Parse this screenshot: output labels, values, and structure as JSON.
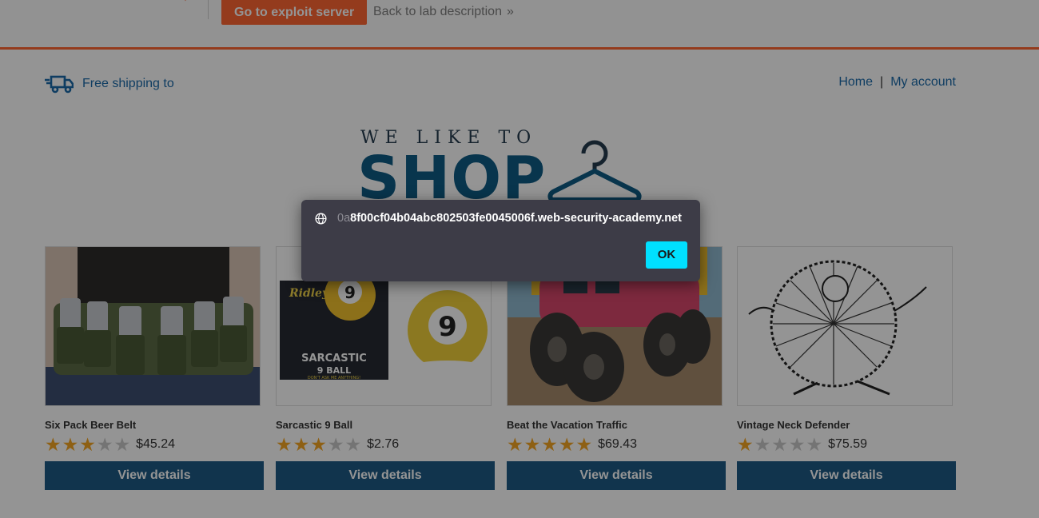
{
  "header": {
    "exploit_button": "Go to exploit server",
    "back_link": "Back to lab description",
    "back_chevron": "»"
  },
  "nav": {
    "shipping_text": "Free shipping to",
    "home": "Home",
    "separator": "|",
    "my_account": "My account"
  },
  "hero": {
    "tagline": "WE LIKE TO",
    "word": "SHOP"
  },
  "products": [
    {
      "name": "Six Pack Beer Belt",
      "rating": 3,
      "price": "$45.24",
      "button": "View details"
    },
    {
      "name": "Sarcastic 9 Ball",
      "rating": 3,
      "price": "$2.76",
      "button": "View details"
    },
    {
      "name": "Beat the Vacation Traffic",
      "rating": 5,
      "price": "$69.43",
      "button": "View details"
    },
    {
      "name": "Vintage Neck Defender",
      "rating": 1,
      "price": "$75.59",
      "button": "View details"
    }
  ],
  "product_images": {
    "ball_box_brand": "Ridley's",
    "ball_box_line1": "SARCASTIC",
    "ball_box_line2": "9 BALL",
    "ball_box_tagline": "DON'T ASK ME ANYTHING!",
    "ball_number": "9"
  },
  "dialog": {
    "origin_faded": "0a",
    "origin": "8f00cf04b04abc802503fe0045006f.web-security-academy.net",
    "ok_label": "OK"
  },
  "colors": {
    "accent": "#ff6633",
    "link": "#1b6aa9",
    "button": "#1e5b86",
    "star": "#f5a623",
    "dialog_bg": "#3d3c47",
    "ok_button": "#00e0ff"
  }
}
